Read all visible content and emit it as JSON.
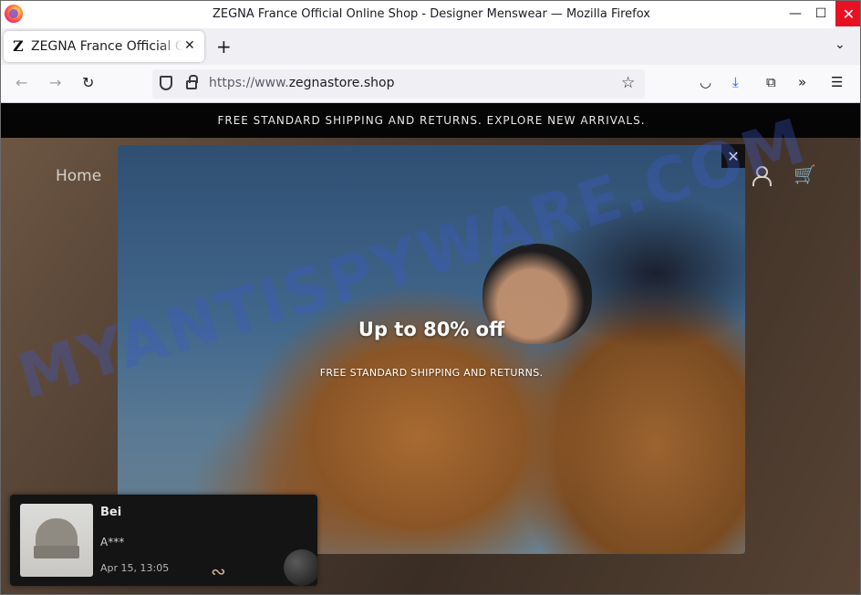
{
  "window": {
    "title": "ZEGNA France Official Online Shop - Designer Menswear — Mozilla Firefox",
    "minimize_glyph": "—",
    "maximize_glyph": "☐",
    "close_glyph": "✕"
  },
  "tabs": [
    {
      "favicon_letter": "Z",
      "label": "ZEGNA France Official Online Shop",
      "close_glyph": "✕"
    }
  ],
  "tabstrip": {
    "new_tab_glyph": "+",
    "list_all_glyph": "⌄"
  },
  "navbar": {
    "back_glyph": "←",
    "forward_glyph": "→",
    "reload_glyph": "↻",
    "url_scheme": "https://www.",
    "url_host": "zegnastore.shop",
    "bookmark_glyph": "☆",
    "pocket_glyph": "◡",
    "download_glyph": "⤓",
    "extensions_glyph": "⧉",
    "overflow_glyph": "»",
    "menu_glyph": "☰"
  },
  "page": {
    "announcement": "FREE STANDARD SHIPPING AND RETURNS. EXPLORE NEW ARRIVALS.",
    "nav_home": "Home",
    "cart_glyph": "🛒",
    "watermark": "MYANTISPYWARE.COM"
  },
  "popup": {
    "title": "Up to 80% off",
    "subtitle": "FREE STANDARD SHIPPING AND RETURNS.",
    "close_glyph": "✕"
  },
  "notification": {
    "title": "Bei",
    "buyer": "A***",
    "time": "Apr 15, 13:05",
    "deco_glyph": "∾"
  },
  "colors": {
    "announcement_bg": "#050505",
    "download_accent": "#0061e0",
    "window_close_bg": "#e81123"
  }
}
